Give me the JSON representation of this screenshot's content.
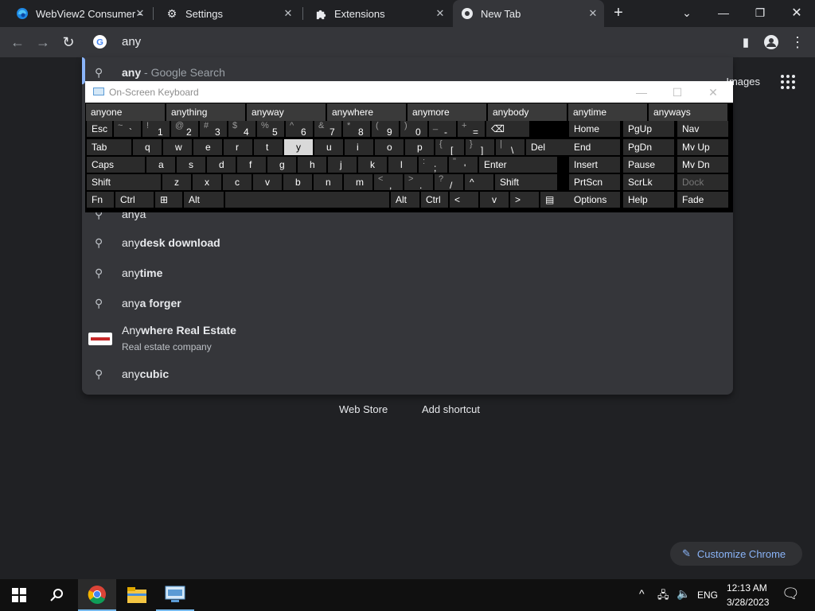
{
  "tabs": [
    {
      "title": "WebView2 Consumer -",
      "icon": "edge-icon"
    },
    {
      "title": "Settings",
      "icon": "gear-icon"
    },
    {
      "title": "Extensions",
      "icon": "puzzle-icon"
    },
    {
      "title": "New Tab",
      "icon": "chrome-icon"
    }
  ],
  "omnibox": {
    "value": "any"
  },
  "suggestions": [
    {
      "bold_prefix": "any",
      "rest": " - Google Search"
    },
    {
      "text": "anya"
    },
    {
      "prefix": "any",
      "bold": "desk download"
    },
    {
      "prefix": "any",
      "bold": "time"
    },
    {
      "prefix": "any",
      "bold": "a forger"
    },
    {
      "prefix": "Any",
      "bold": "where Real Estate",
      "subtitle": "Real estate company"
    },
    {
      "prefix": "any",
      "bold": "cubic"
    }
  ],
  "header_links": {
    "images": "Images"
  },
  "osk": {
    "title": "On-Screen Keyboard",
    "predictions": [
      "anyone",
      "anything",
      "anyway",
      "anywhere",
      "anymore",
      "anybody",
      "anytime",
      "anyways"
    ],
    "rows": [
      [
        {
          "l": "Esc"
        },
        {
          "s": "~",
          "m": "`"
        },
        {
          "s": "!",
          "m": "1"
        },
        {
          "s": "@",
          "m": "2"
        },
        {
          "s": "#",
          "m": "3"
        },
        {
          "s": "$",
          "m": "4"
        },
        {
          "s": "%",
          "m": "5"
        },
        {
          "s": "^",
          "m": "6"
        },
        {
          "s": "&",
          "m": "7"
        },
        {
          "s": "*",
          "m": "8"
        },
        {
          "s": "(",
          "m": "9"
        },
        {
          "s": ")",
          "m": "0"
        },
        {
          "s": "_",
          "m": "-"
        },
        {
          "s": "+",
          "m": "="
        },
        {
          "l": "⌫"
        }
      ],
      [
        {
          "l": "Tab"
        },
        {
          "l": "q"
        },
        {
          "l": "w"
        },
        {
          "l": "e"
        },
        {
          "l": "r"
        },
        {
          "l": "t"
        },
        {
          "l": "y"
        },
        {
          "l": "u"
        },
        {
          "l": "i"
        },
        {
          "l": "o"
        },
        {
          "l": "p"
        },
        {
          "s": "{",
          "m": "["
        },
        {
          "s": "}",
          "m": "]"
        },
        {
          "s": "|",
          "m": "\\"
        },
        {
          "l": "Del"
        }
      ],
      [
        {
          "l": "Caps"
        },
        {
          "l": "a"
        },
        {
          "l": "s"
        },
        {
          "l": "d"
        },
        {
          "l": "f"
        },
        {
          "l": "g"
        },
        {
          "l": "h"
        },
        {
          "l": "j"
        },
        {
          "l": "k"
        },
        {
          "l": "l"
        },
        {
          "s": ":",
          "m": ";"
        },
        {
          "s": "\"",
          "m": "'"
        },
        {
          "l": "Enter"
        }
      ],
      [
        {
          "l": "Shift"
        },
        {
          "l": "z"
        },
        {
          "l": "x"
        },
        {
          "l": "c"
        },
        {
          "l": "v"
        },
        {
          "l": "b"
        },
        {
          "l": "n"
        },
        {
          "l": "m"
        },
        {
          "s": "<",
          "m": ","
        },
        {
          "s": ">",
          "m": "."
        },
        {
          "s": "?",
          "m": "/"
        },
        {
          "l": "^"
        },
        {
          "l": "Shift"
        }
      ],
      [
        {
          "l": "Fn"
        },
        {
          "l": "Ctrl"
        },
        {
          "l": "⊞"
        },
        {
          "l": "Alt"
        },
        {
          "l": ""
        },
        {
          "l": "Alt"
        },
        {
          "l": "Ctrl"
        },
        {
          "l": "<"
        },
        {
          "l": "v"
        },
        {
          "l": ">"
        },
        {
          "l": "▤"
        }
      ]
    ],
    "nav": [
      [
        "Home",
        "PgUp",
        "Nav"
      ],
      [
        "End",
        "PgDn",
        "Mv Up"
      ],
      [
        "Insert",
        "Pause",
        "Mv Dn"
      ],
      [
        "PrtScn",
        "ScrLk",
        "Dock"
      ],
      [
        "Options",
        "Help",
        "Fade"
      ]
    ]
  },
  "shortcuts": {
    "web_store": "Web Store",
    "add_shortcut": "Add shortcut"
  },
  "customize": "Customize Chrome",
  "taskbar": {
    "time": "12:13 AM",
    "date": "3/28/2023",
    "lang": "ENG"
  }
}
